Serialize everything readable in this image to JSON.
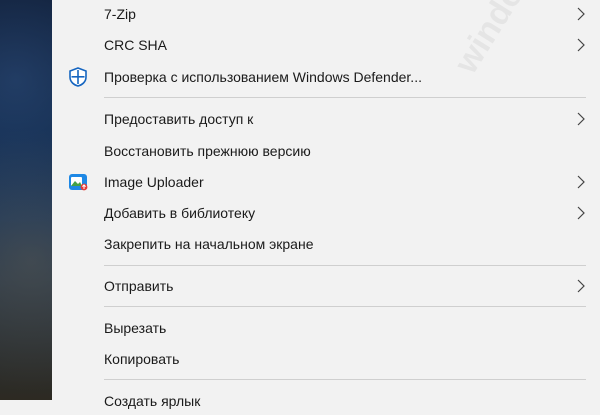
{
  "menu": {
    "items": [
      {
        "label": "7-Zip"
      },
      {
        "label": "CRC SHA"
      },
      {
        "label": "Проверка с использованием Windows Defender..."
      },
      {
        "label": "Предоставить доступ к"
      },
      {
        "label": "Восстановить прежнюю версию"
      },
      {
        "label": "Image Uploader"
      },
      {
        "label": "Добавить в библиотеку"
      },
      {
        "label": "Закрепить на начальном экране"
      },
      {
        "label": "Отправить"
      },
      {
        "label": "Вырезать"
      },
      {
        "label": "Копировать"
      },
      {
        "label": "Создать ярлык"
      }
    ]
  },
  "watermark": {
    "text": "windowstips.ru"
  },
  "colors": {
    "menu_bg": "#f2f2f2",
    "separator": "#cfcfcf",
    "defender_blue": "#1565c0"
  }
}
